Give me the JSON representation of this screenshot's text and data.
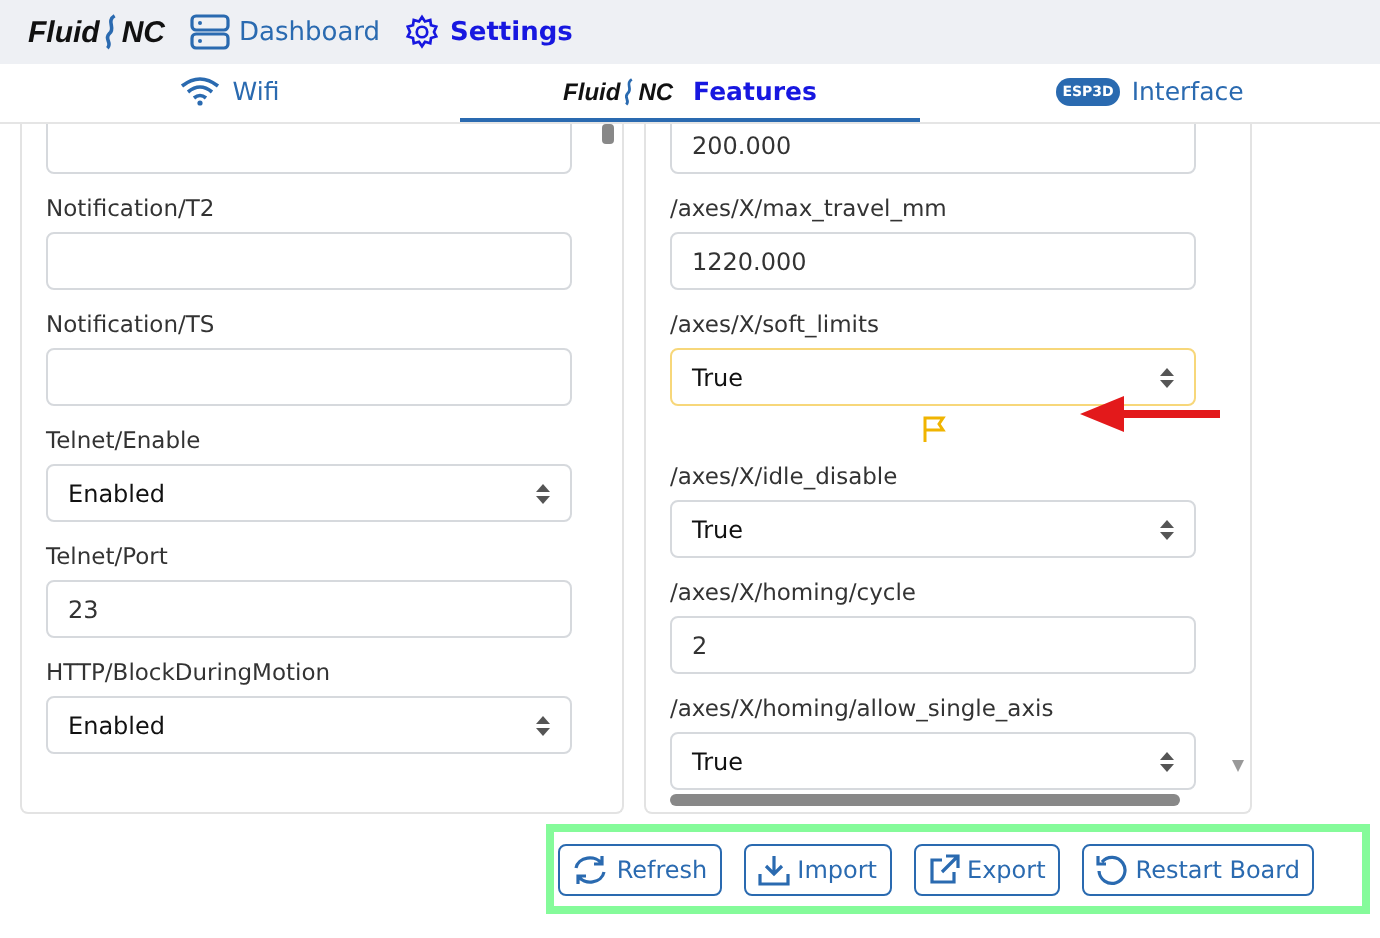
{
  "nav": {
    "logo": {
      "left": "Fluid",
      "right": "NC"
    },
    "items": [
      {
        "label": "Dashboard",
        "selected": false
      },
      {
        "label": "Settings",
        "selected": true
      }
    ]
  },
  "tabs": [
    {
      "label": "Wifi",
      "selected": false
    },
    {
      "label": "Features",
      "logo": {
        "left": "Fluid",
        "right": "NC"
      },
      "selected": true
    },
    {
      "label": "Interface",
      "badge": "ESP3D",
      "selected": false
    }
  ],
  "left_panel": {
    "fields": [
      {
        "kind": "text"
      },
      {
        "kind": "text",
        "label": "Notification/T2"
      },
      {
        "kind": "text",
        "label": "Notification/TS"
      },
      {
        "kind": "select",
        "label": "Telnet/Enable",
        "value": "Enabled"
      },
      {
        "kind": "text",
        "label": "Telnet/Port",
        "value": "23"
      },
      {
        "kind": "select",
        "label": "HTTP/BlockDuringMotion",
        "value": "Enabled"
      }
    ]
  },
  "right_panel": {
    "fields": [
      {
        "kind": "text",
        "value": "200.000",
        "modified": false
      },
      {
        "kind": "text",
        "label": "/axes/X/max_travel_mm",
        "value": "1220.000",
        "modified": false
      },
      {
        "kind": "select",
        "label": "/axes/X/soft_limits",
        "value": "True",
        "modified": true
      },
      {
        "kind": "select",
        "label": "/axes/X/idle_disable",
        "value": "True",
        "modified": false
      },
      {
        "kind": "text",
        "label": "/axes/X/homing/cycle",
        "value": "2",
        "modified": false
      },
      {
        "kind": "select",
        "label": "/axes/X/homing/allow_single_axis",
        "value": "True",
        "modified": false
      }
    ]
  },
  "buttons": [
    {
      "label": "Refresh"
    },
    {
      "label": "Import"
    },
    {
      "label": "Export"
    },
    {
      "label": "Restart Board"
    }
  ]
}
